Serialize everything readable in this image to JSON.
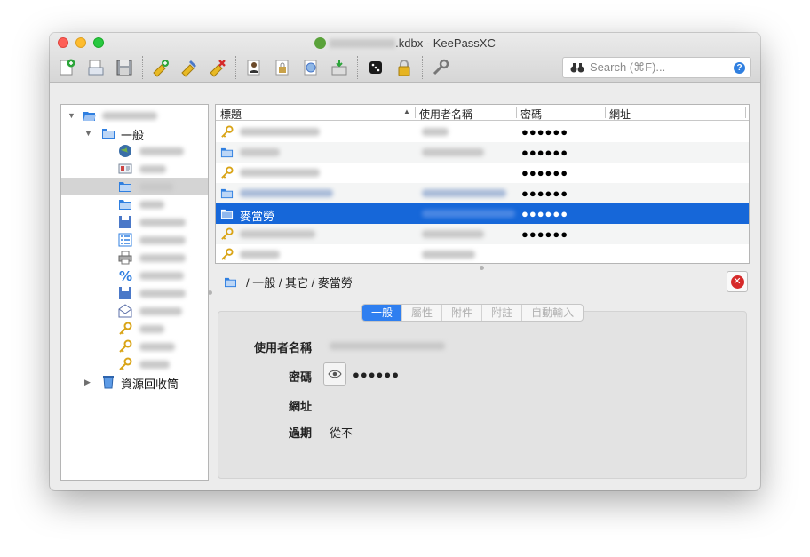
{
  "window": {
    "title_suffix": ".kdbx - KeePassXC"
  },
  "toolbar": {
    "icons": [
      "new-database-icon",
      "open-database-icon",
      "save-database-icon",
      "new-entry-icon",
      "edit-entry-icon",
      "delete-entry-icon",
      "copy-username-icon",
      "copy-password-icon",
      "copy-url-icon",
      "autotype-icon",
      "password-generator-icon",
      "lock-database-icon",
      "settings-icon"
    ]
  },
  "search": {
    "placeholder": "Search (⌘F)...",
    "help_glyph": "?"
  },
  "tree": {
    "group_general": "一般",
    "recycle_bin": "資源回收筒"
  },
  "table": {
    "columns": [
      "標題",
      "使用者名稱",
      "密碼",
      "網址"
    ],
    "password_mask": "●●●●●●",
    "selected_title": "麥當勞"
  },
  "path": {
    "text": "/ 一般 / 其它 / 麥當勞"
  },
  "details": {
    "tabs": [
      "一般",
      "屬性",
      "附件",
      "附註",
      "自動輸入"
    ],
    "username_label": "使用者名稱",
    "password_label": "密碼",
    "password_value": "●●●●●●",
    "url_label": "網址",
    "expires_label": "過期",
    "expires_value": "從不"
  },
  "colors": {
    "selection": "#1667d9",
    "tab_active": "#2f7ff0",
    "close_red": "#d62a2a"
  }
}
